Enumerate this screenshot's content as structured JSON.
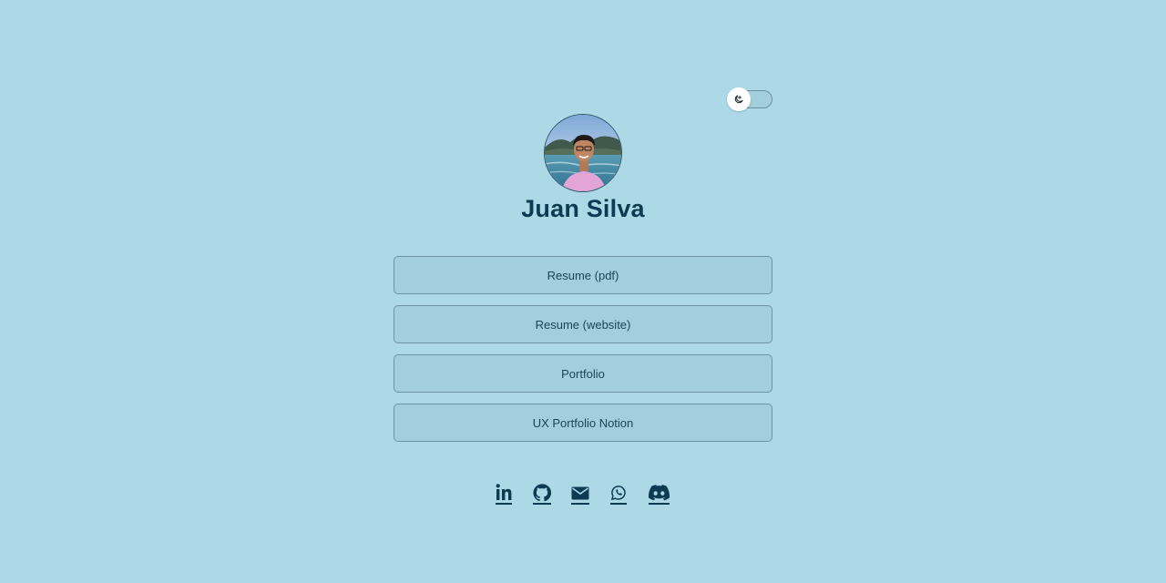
{
  "profile": {
    "name": "Juan Silva",
    "avatar_alt": "Juan Silva"
  },
  "theme_toggle": {
    "icon": "moon-icon",
    "state": "light"
  },
  "links": [
    {
      "label": "Resume (pdf)"
    },
    {
      "label": "Resume (website)"
    },
    {
      "label": "Portfolio"
    },
    {
      "label": "UX Portfolio Notion"
    }
  ],
  "socials": [
    {
      "icon": "linkedin-icon"
    },
    {
      "icon": "github-icon"
    },
    {
      "icon": "email-icon"
    },
    {
      "icon": "whatsapp-icon"
    },
    {
      "icon": "discord-icon"
    }
  ],
  "colors": {
    "background": "#add8e6",
    "button_bg": "#a3cede",
    "button_border": "#6f93a4",
    "text": "#0c3b52"
  }
}
